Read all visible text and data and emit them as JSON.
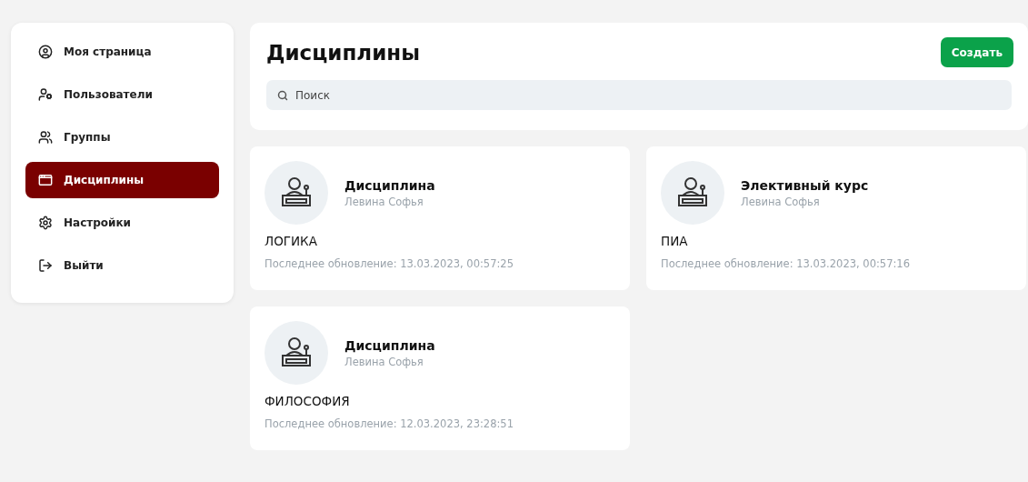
{
  "sidebar": {
    "items": [
      {
        "label": "Моя страница",
        "kind": "profile",
        "selected": false
      },
      {
        "label": "Пользователи",
        "kind": "users",
        "selected": false
      },
      {
        "label": "Группы",
        "kind": "groups",
        "selected": false
      },
      {
        "label": "Дисциплины",
        "kind": "disciplines",
        "selected": true
      },
      {
        "label": "Настройки",
        "kind": "settings",
        "selected": false
      },
      {
        "label": "Выйти",
        "kind": "logout",
        "selected": false
      }
    ]
  },
  "header": {
    "title": "Дисциплины",
    "create_button": "Создать",
    "search": {
      "placeholder": "Поиск"
    }
  },
  "courses": [
    {
      "type": "Дисциплина",
      "author": "Левина Софья",
      "name": "ЛОГИКА",
      "updated": "Последнее обновление: 13.03.2023, 00:57:25"
    },
    {
      "type": "Элективный курс",
      "author": "Левина Софья",
      "name": "ПИА",
      "updated": "Последнее обновление: 13.03.2023, 00:57:16"
    },
    {
      "type": "Дисциплина",
      "author": "Левина Софья",
      "name": "ФИЛОСОФИЯ",
      "updated": "Последнее обновление: 12.03.2023, 23:28:51"
    }
  ]
}
